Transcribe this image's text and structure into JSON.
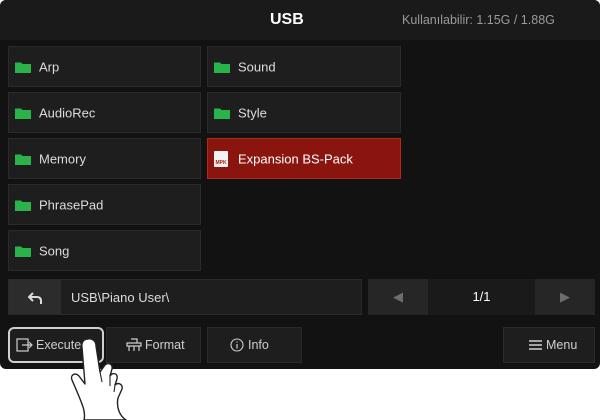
{
  "header": {
    "title": "USB",
    "storage": "Kullanılabilir: 1.15G / 1.88G"
  },
  "folders": [
    {
      "label": "Arp",
      "icon": "folder-icon",
      "selected": false
    },
    {
      "label": "AudioRec",
      "icon": "folder-icon",
      "selected": false
    },
    {
      "label": "Memory",
      "icon": "folder-icon",
      "selected": false
    },
    {
      "label": "PhrasePad",
      "icon": "folder-icon",
      "selected": false
    },
    {
      "label": "Song",
      "icon": "folder-icon",
      "selected": false
    },
    {
      "label": "Sound",
      "icon": "folder-icon",
      "selected": false
    },
    {
      "label": "Style",
      "icon": "folder-icon",
      "selected": false
    },
    {
      "label": "Expansion BS-Pack",
      "icon": "mpk-file-icon",
      "icon_text": "MPK",
      "selected": true
    }
  ],
  "navigation": {
    "back_icon": "back-arrow-icon",
    "path": "USB\\Piano User\\",
    "page": "1/1",
    "prev_icon": "left-arrow-icon",
    "next_icon": "right-arrow-icon"
  },
  "toolbar": {
    "execute": "Execute",
    "format": "Format",
    "info": "Info",
    "menu": "Menu"
  },
  "colors": {
    "background": "#121212",
    "tile": "#1e1e1e",
    "selected": "#8a150f",
    "folder": "#29b34a",
    "text": "#dcdcdc",
    "muted": "#9a9a9a"
  }
}
